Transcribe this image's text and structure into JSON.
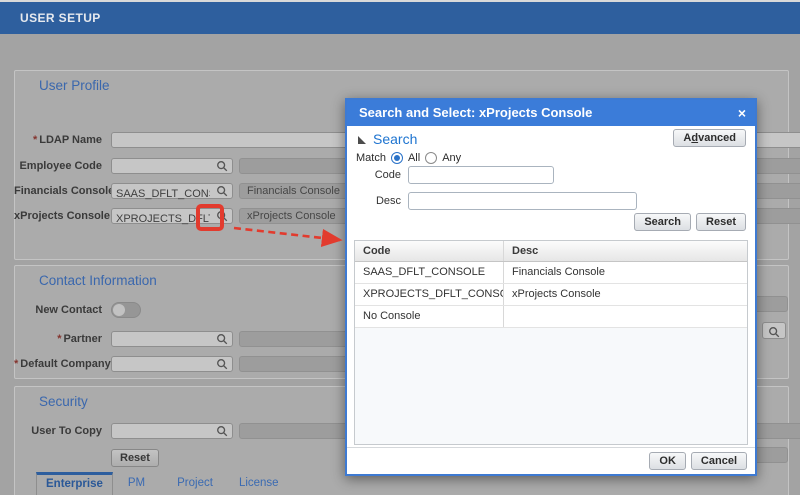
{
  "required_marker": "*",
  "header": {
    "title": "USER SETUP"
  },
  "panels": {
    "user_profile": {
      "title": "User Profile",
      "fields": {
        "ldap_name": {
          "label": "LDAP Name",
          "required": true,
          "value": ""
        },
        "employee_code": {
          "label": "Employee Code",
          "value": "",
          "desc": ""
        },
        "financials_console": {
          "label": "Financials Console",
          "value": "SAAS_DFLT_CONSOLE",
          "desc": "Financials Console"
        },
        "xprojects_console": {
          "label": "xProjects Console",
          "value": "XPROJECTS_DFLT_CONSOLE",
          "desc": "xProjects Console"
        }
      }
    },
    "contact": {
      "title": "Contact Information",
      "fields": {
        "new_contact": {
          "label": "New Contact",
          "toggle_on": false
        },
        "partner": {
          "label": "Partner",
          "required": true,
          "value": "",
          "desc": ""
        },
        "default_company": {
          "label": "Default Company",
          "required": true,
          "value": "",
          "desc": ""
        }
      }
    },
    "security": {
      "title": "Security",
      "fields": {
        "user_to_copy": {
          "label": "User To Copy",
          "value": "",
          "desc": ""
        }
      },
      "reset_label": "Reset",
      "tabs": [
        {
          "label": "Enterprise",
          "active": true
        },
        {
          "label": "PM",
          "active": false
        },
        {
          "label": "Project",
          "active": false
        },
        {
          "label": "License",
          "active": false
        }
      ]
    }
  },
  "modal": {
    "title": "Search and Select: xProjects Console",
    "close_label": "×",
    "search_section": {
      "title": "Search",
      "advanced_button": {
        "pre": "A",
        "underlined": "d",
        "post": "vanced"
      }
    },
    "match": {
      "label": "Match",
      "options": [
        {
          "label": "All",
          "selected": true
        },
        {
          "label": "Any",
          "selected": false
        }
      ]
    },
    "inputs": {
      "code": {
        "label": "Code",
        "value": ""
      },
      "desc": {
        "label": "Desc",
        "value": ""
      }
    },
    "buttons": {
      "search": "Search",
      "reset": "Reset",
      "ok": "OK",
      "cancel": "Cancel"
    },
    "table": {
      "columns": [
        "Code",
        "Desc"
      ],
      "rows": [
        [
          "SAAS_DFLT_CONSOLE",
          "Financials Console"
        ],
        [
          "XPROJECTS_DFLT_CONSOLE",
          "xProjects Console"
        ],
        [
          "No Console",
          ""
        ]
      ]
    }
  },
  "icons": {
    "lookup": "magnifier",
    "disclosure": "triangle-expanded"
  },
  "colors": {
    "titlebar_blue": "#3b7cd9",
    "page_header_blue": "#2e5f9e",
    "section_heading_blue": "#3a67ad",
    "link_blue": "#1e74d0",
    "annotation_red": "#e23b2e"
  }
}
